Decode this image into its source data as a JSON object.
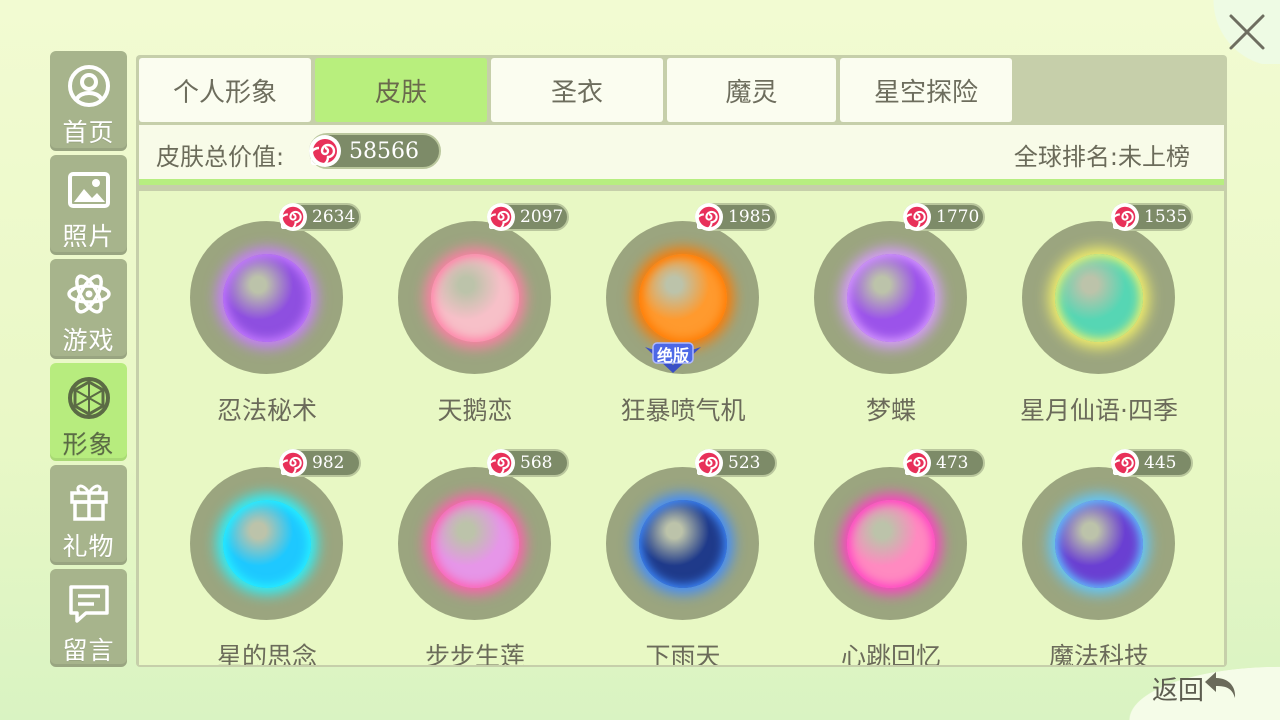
{
  "sidebar": {
    "items": [
      {
        "label": "首页",
        "icon": "user-circle-icon",
        "active": false
      },
      {
        "label": "照片",
        "icon": "photo-icon",
        "active": false
      },
      {
        "label": "游戏",
        "icon": "atom-icon",
        "active": false
      },
      {
        "label": "形象",
        "icon": "gem-icon",
        "active": true
      },
      {
        "label": "礼物",
        "icon": "gift-icon",
        "active": false
      },
      {
        "label": "留言",
        "icon": "message-icon",
        "active": false
      }
    ]
  },
  "tabs": [
    {
      "label": "个人形象",
      "active": false
    },
    {
      "label": "皮肤",
      "active": true
    },
    {
      "label": "圣衣",
      "active": false
    },
    {
      "label": "魔灵",
      "active": false
    },
    {
      "label": "星空探险",
      "active": false
    }
  ],
  "summary": {
    "total_label": "皮肤总价值:",
    "total_value": "58566",
    "rank_text": "全球排名:未上榜"
  },
  "skins": [
    {
      "name": "忍法秘术",
      "price": "2634",
      "orb": "#8e4fe0",
      "glow": "#c77dff"
    },
    {
      "name": "天鹅恋",
      "price": "2097",
      "orb": "#f7c0c8",
      "glow": "#ff7fa6"
    },
    {
      "name": "狂暴喷气机",
      "price": "1985",
      "orb": "#ff9a2e",
      "glow": "#ff7a00",
      "badge": "绝版"
    },
    {
      "name": "梦蝶",
      "price": "1770",
      "orb": "#9b53ea",
      "glow": "#d79bff"
    },
    {
      "name": "星月仙语·四季",
      "price": "1535",
      "orb": "#56d6b4",
      "glow": "#f4f16a"
    },
    {
      "name": "星的思念",
      "price": "982",
      "orb": "#1ec8ff",
      "glow": "#28f2ff"
    },
    {
      "name": "步步生莲",
      "price": "568",
      "orb": "#e696e8",
      "glow": "#ff5fb0"
    },
    {
      "name": "下雨天",
      "price": "523",
      "orb": "#1f3a8a",
      "glow": "#3f8cff"
    },
    {
      "name": "心跳回忆",
      "price": "473",
      "orb": "#ff8ac0",
      "glow": "#ff3fc4"
    },
    {
      "name": "魔法科技",
      "price": "445",
      "orb": "#6a3fd2",
      "glow": "#5fc7ff"
    }
  ],
  "footer": {
    "back_label": "返回"
  },
  "colors": {
    "accent": "#b7ec7e",
    "sidebar": "#a7b48c",
    "panel": "#e8f8c4",
    "coin": "#e8305a"
  }
}
